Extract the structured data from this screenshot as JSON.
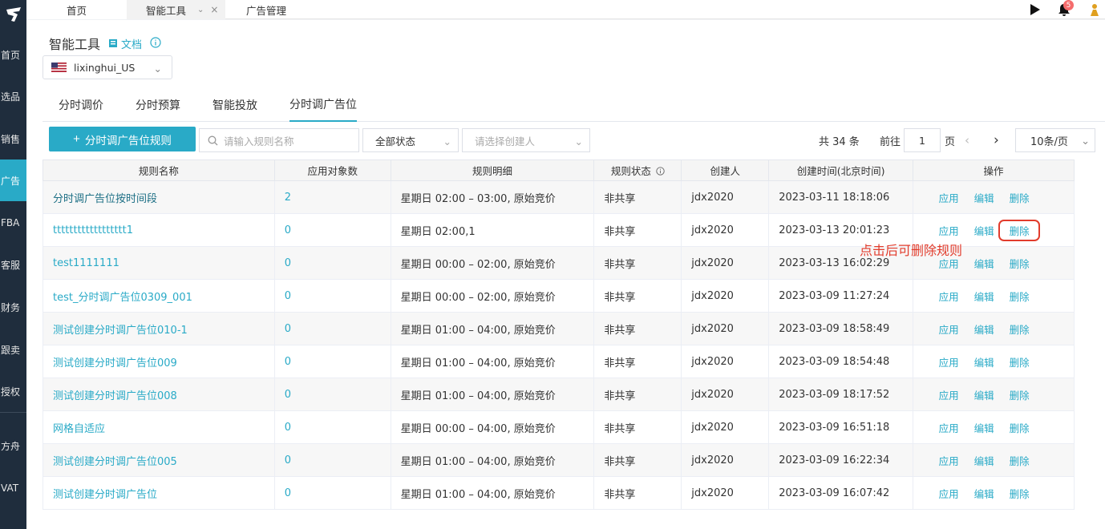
{
  "sidebar": {
    "items": [
      {
        "label": "首页",
        "active": false
      },
      {
        "label": "选品",
        "active": false
      },
      {
        "label": "销售",
        "active": false
      },
      {
        "label": "广告",
        "active": true
      },
      {
        "label": "FBA",
        "active": false
      },
      {
        "label": "客服",
        "active": false
      },
      {
        "label": "财务",
        "active": false
      },
      {
        "label": "跟卖",
        "active": false
      },
      {
        "label": "授权",
        "active": false
      },
      {
        "label": "方舟",
        "active": false
      },
      {
        "label": "VAT",
        "active": false
      }
    ]
  },
  "topbar": {
    "tabs": [
      {
        "label": "首页"
      },
      {
        "label": "智能工具"
      },
      {
        "label": "广告管理"
      }
    ],
    "notification_count": "5"
  },
  "page": {
    "title": "智能工具",
    "doc_label": "文档",
    "account": "lixinghui_US"
  },
  "subtabs": [
    {
      "label": "分时调价"
    },
    {
      "label": "分时预算"
    },
    {
      "label": "智能投放"
    },
    {
      "label": "分时调广告位"
    }
  ],
  "toolbar": {
    "create_label": "分时调广告位规则",
    "search_placeholder": "请输入规则名称",
    "status_value": "全部状态",
    "creator_placeholder": "请选择创建人"
  },
  "pager": {
    "total": "共 34 条",
    "goto": "前往",
    "page": "1",
    "page_unit": "页",
    "page_size": "10条/页"
  },
  "table": {
    "headers": [
      "规则名称",
      "应用对象数",
      "规则明细",
      "规则状态",
      "创建人",
      "创建时间(北京时间)",
      "操作"
    ],
    "op_apply": "应用",
    "op_edit": "编辑",
    "op_delete": "删除",
    "rows": [
      {
        "name": "分时调广告位按时间段",
        "count": "2",
        "detail": "星期日 02:00 – 03:00, 原始竞价",
        "status": "非共享",
        "creator": "jdx2020",
        "created": "2023-03-11 18:18:06"
      },
      {
        "name": "tttttttttttttttttt1",
        "count": "0",
        "detail": "星期日 02:00,1",
        "status": "非共享",
        "creator": "jdx2020",
        "created": "2023-03-13 20:01:23"
      },
      {
        "name": "test1111111",
        "count": "0",
        "detail": "星期日 00:00 – 02:00, 原始竞价",
        "status": "非共享",
        "creator": "jdx2020",
        "created": "2023-03-13 16:02:29"
      },
      {
        "name": "test_分时调广告位0309_001",
        "count": "0",
        "detail": "星期日 00:00 – 02:00, 原始竞价",
        "status": "非共享",
        "creator": "jdx2020",
        "created": "2023-03-09 11:27:24"
      },
      {
        "name": "测试创建分时调广告位010-1",
        "count": "0",
        "detail": "星期日 01:00 – 04:00, 原始竞价",
        "status": "非共享",
        "creator": "jdx2020",
        "created": "2023-03-09 18:58:49"
      },
      {
        "name": "测试创建分时调广告位009",
        "count": "0",
        "detail": "星期日 01:00 – 04:00, 原始竞价",
        "status": "非共享",
        "creator": "jdx2020",
        "created": "2023-03-09 18:54:48"
      },
      {
        "name": "测试创建分时调广告位008",
        "count": "0",
        "detail": "星期日 01:00 – 04:00, 原始竞价",
        "status": "非共享",
        "creator": "jdx2020",
        "created": "2023-03-09 18:17:52"
      },
      {
        "name": "网格自适应",
        "count": "0",
        "detail": "星期日 00:00 – 04:00, 原始竞价",
        "status": "非共享",
        "creator": "jdx2020",
        "created": "2023-03-09 16:51:18"
      },
      {
        "name": "测试创建分时调广告位005",
        "count": "0",
        "detail": "星期日 01:00 – 04:00, 原始竞价",
        "status": "非共享",
        "creator": "jdx2020",
        "created": "2023-03-09 16:22:34"
      },
      {
        "name": "测试创建分时调广告位",
        "count": "0",
        "detail": "星期日 01:00 – 04:00, 原始竞价",
        "status": "非共享",
        "creator": "jdx2020",
        "created": "2023-03-09 16:07:42"
      }
    ]
  },
  "annotation": "点击后可删除规则",
  "colors": {
    "accent": "#29aac7",
    "sidebar": "#1f2d3d",
    "annotation": "#e23c2c"
  }
}
